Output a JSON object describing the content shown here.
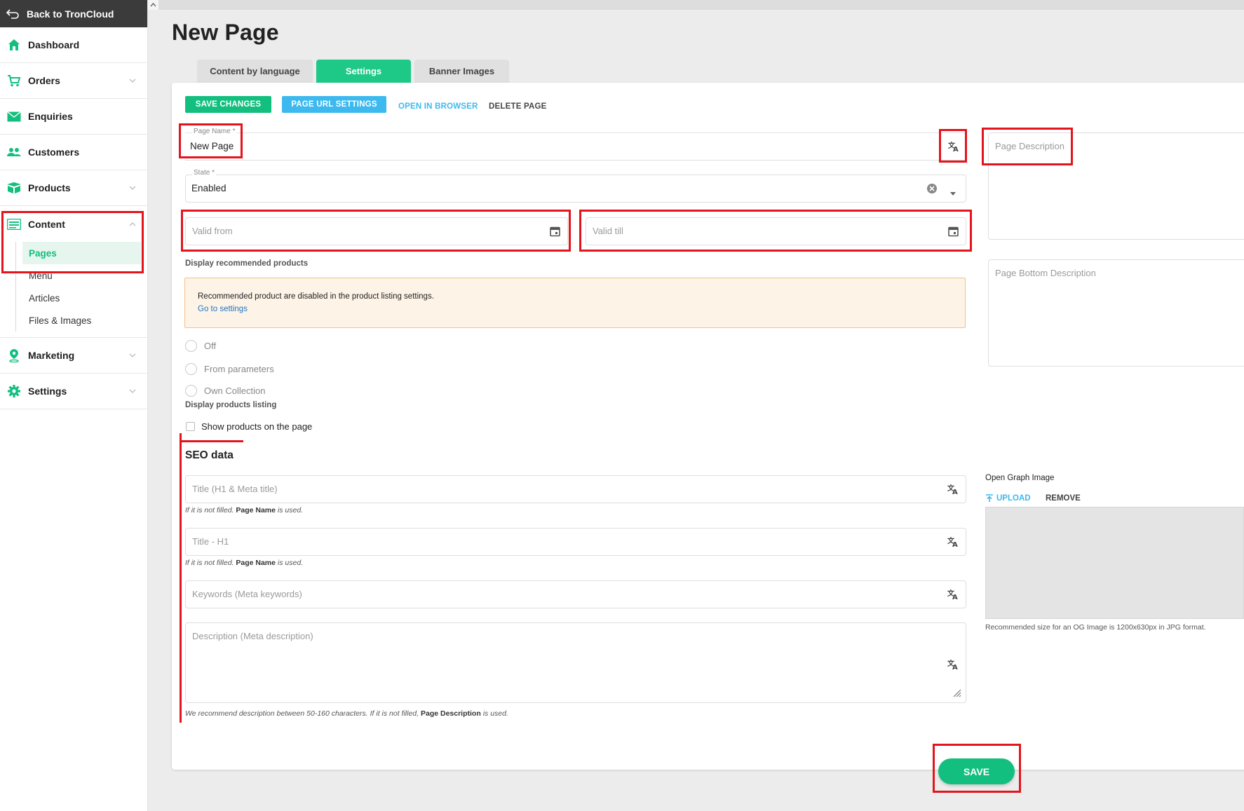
{
  "sidebar": {
    "back_label": "Back to TronCloud",
    "items": [
      {
        "label": "Dashboard",
        "icon": "home-icon"
      },
      {
        "label": "Orders",
        "icon": "cart-icon"
      },
      {
        "label": "Enquiries",
        "icon": "mail-icon"
      },
      {
        "label": "Customers",
        "icon": "people-icon"
      },
      {
        "label": "Products",
        "icon": "box-icon"
      },
      {
        "label": "Content",
        "icon": "list-icon"
      },
      {
        "label": "Marketing",
        "icon": "pin-icon"
      },
      {
        "label": "Settings",
        "icon": "gear-icon"
      }
    ],
    "content_sub": [
      "Pages",
      "Menu",
      "Articles",
      "Files & Images"
    ],
    "active_sub": "Pages"
  },
  "page": {
    "title": "New Page"
  },
  "tabs": [
    {
      "label": "Content by language"
    },
    {
      "label": "Settings"
    },
    {
      "label": "Banner Images"
    }
  ],
  "active_tab": "Settings",
  "toolbar": {
    "save_changes": "SAVE CHANGES",
    "page_url_settings": "PAGE URL SETTINGS",
    "open_in_browser": "OPEN IN BROWSER",
    "delete_page": "DELETE PAGE"
  },
  "form": {
    "page_name_label": "Page Name *",
    "page_name_value": "New Page",
    "state_label": "State *",
    "state_value": "Enabled",
    "valid_from_placeholder": "Valid from",
    "valid_till_placeholder": "Valid till",
    "page_description_placeholder": "Page Description",
    "page_bottom_description_placeholder": "Page Bottom Description",
    "display_recommended_label": "Display recommended products",
    "warning_text": "Recommended product are disabled in the product listing settings.",
    "warning_link": "Go to settings",
    "radio_options": [
      "Off",
      "From parameters",
      "Own Collection"
    ],
    "display_listing_label": "Display products listing",
    "show_products_label": "Show products on the page"
  },
  "seo": {
    "heading": "SEO data",
    "title_placeholder": "Title (H1 & Meta title)",
    "title_hint_pre": "If it is not filled.",
    "title_hint_bold": "Page Name",
    "title_hint_post": "is used.",
    "h1_placeholder": "Title - H1",
    "h1_hint_pre": "If it is not filled.",
    "h1_hint_bold": "Page Name",
    "h1_hint_post": "is used.",
    "keywords_placeholder": "Keywords (Meta keywords)",
    "description_placeholder": "Description (Meta description)",
    "description_hint_pre": "We recommend description between 50-160 characters. If it is not filled,",
    "description_hint_bold": "Page Description",
    "description_hint_post": "is used."
  },
  "og": {
    "label": "Open Graph Image",
    "upload": "UPLOAD",
    "remove": "REMOVE",
    "hint": "Recommended size for an OG Image is 1200x630px in JPG format."
  },
  "footer": {
    "save": "SAVE"
  },
  "colors": {
    "accent_green": "#13bf7e",
    "accent_blue": "#3cb9ef",
    "highlight_red": "#e4141c"
  }
}
